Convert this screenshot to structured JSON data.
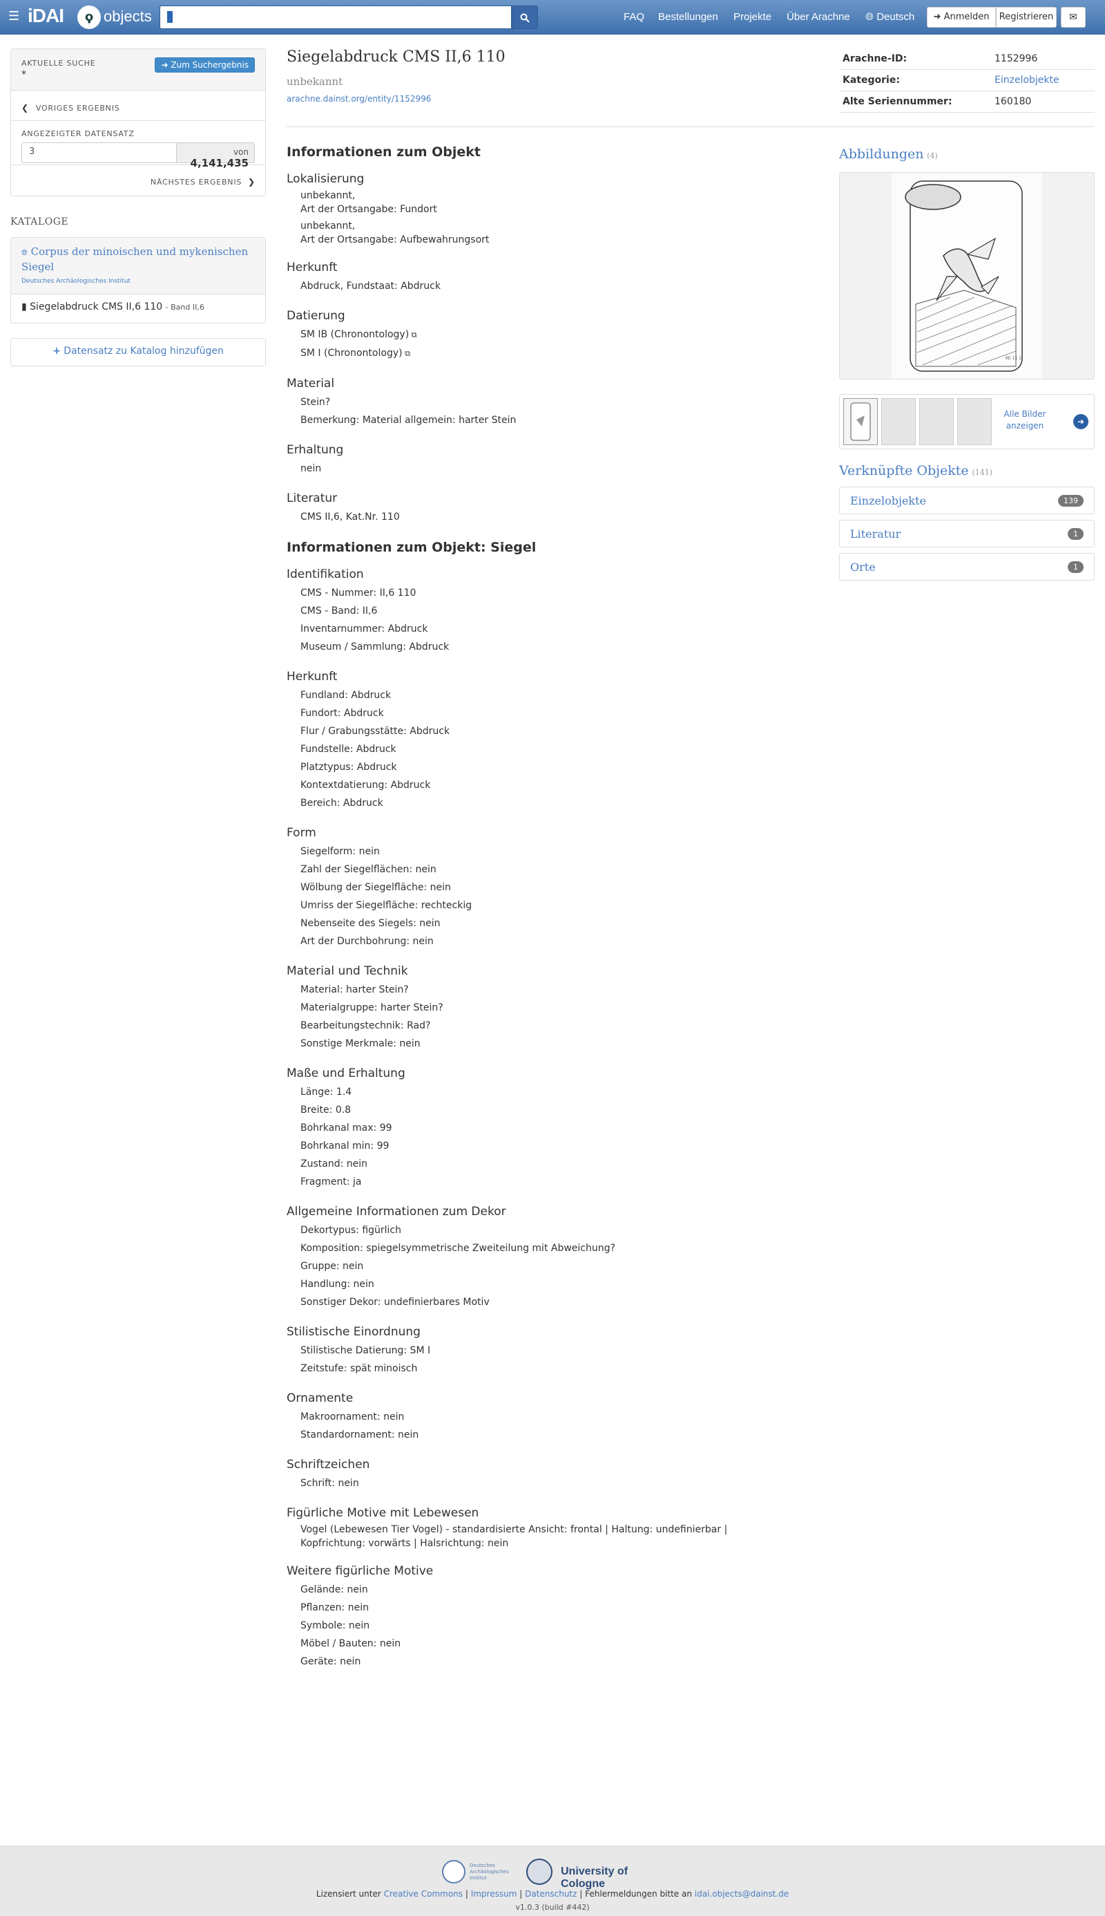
{
  "nav": {
    "logo": "iDAI",
    "brand": "objects",
    "search_value": "",
    "links": [
      "FAQ",
      "Bestellungen",
      "Projekte",
      "Über Arachne"
    ],
    "language": "Deutsch",
    "login": "Anmelden",
    "register": "Registrieren"
  },
  "search_panel": {
    "current_label": "Aktuelle Suche",
    "current_value": "*",
    "back_button": "Zum Suchergebnis",
    "prev": "Voriges Ergebnis",
    "record_label": "Angezeigter Datensatz",
    "record_value": "3",
    "of_label": "von",
    "total": "4,141,435",
    "next": "Nächstes Ergebnis"
  },
  "catalogs": {
    "title": "Kataloge",
    "catalog_name": "Corpus der minoischen und mykenischen Siegel",
    "catalog_org": "Deutsches Archäologisches Institut",
    "entry_label": "Siegelabdruck CMS II,6 110",
    "entry_band": "- Band II,6",
    "add_button": "Datensatz zu Katalog hinzufügen"
  },
  "object": {
    "title": "Siegelabdruck CMS II,6 110",
    "subtitle": "unbekannt",
    "url": "arachne.dainst.org/entity/1152996"
  },
  "meta": [
    {
      "key": "Arachne-ID:",
      "value": "1152996"
    },
    {
      "key": "Kategorie:",
      "value": "Einzelobjekte"
    },
    {
      "key": "Alte Seriennummer:",
      "value": "160180"
    }
  ],
  "sections": [
    {
      "title": "Informationen zum Objekt",
      "groups": [
        {
          "title": "Lokalisierung",
          "items": [
            "unbekannt,\nArt der Ortsangabe: Fundort",
            "unbekannt,\nArt der Ortsangabe: Aufbewahrungsort"
          ]
        },
        {
          "title": "Herkunft",
          "items": [
            "Abdruck, Fundstaat: Abdruck"
          ]
        },
        {
          "title": "Datierung",
          "items": [
            "SM IB (Chronontology)",
            "SM I (Chronontology)"
          ]
        },
        {
          "title": "Material",
          "items": [
            "Stein?",
            "Bemerkung: Material allgemein: harter Stein"
          ]
        },
        {
          "title": "Erhaltung",
          "items": [
            "nein"
          ]
        },
        {
          "title": "Literatur",
          "items": [
            "CMS II,6, Kat.Nr. 110"
          ]
        }
      ]
    },
    {
      "title": "Informationen zum Objekt: Siegel",
      "groups": [
        {
          "title": "Identifikation",
          "items": [
            "CMS - Nummer: II,6 110",
            "CMS - Band: II,6",
            "Inventarnummer: Abdruck",
            "Museum / Sammlung: Abdruck"
          ]
        },
        {
          "title": "Herkunft",
          "items": [
            "Fundland: Abdruck",
            "Fundort: Abdruck",
            "Flur / Grabungsstätte: Abdruck",
            "Fundstelle: Abdruck",
            "Platztypus: Abdruck",
            "Kontextdatierung: Abdruck",
            "Bereich: Abdruck"
          ]
        },
        {
          "title": "Form",
          "items": [
            "Siegelform: nein",
            "Zahl der Siegelflächen: nein",
            "Wölbung der Siegelfläche: nein",
            "Umriss der Siegelfläche: rechteckig",
            "Nebenseite des Siegels: nein",
            "Art der Durchbohrung: nein"
          ]
        },
        {
          "title": "Material und Technik",
          "items": [
            "Material: harter Stein?",
            "Materialgruppe: harter Stein?",
            "Bearbeitungstechnik: Rad?",
            "Sonstige Merkmale: nein"
          ]
        },
        {
          "title": "Maße und Erhaltung",
          "items": [
            "Länge: 1.4",
            "Breite: 0.8",
            "Bohrkanal max: 99",
            "Bohrkanal min: 99",
            "Zustand: nein",
            "Fragment: ja"
          ]
        },
        {
          "title": "Allgemeine Informationen zum Dekor",
          "items": [
            "Dekortypus: figürlich",
            "Komposition: spiegelsymmetrische Zweiteilung mit Abweichung?",
            "Gruppe: nein",
            "Handlung: nein",
            "Sonstiger Dekor: undefinierbares Motiv"
          ]
        },
        {
          "title": "Stilistische Einordnung",
          "items": [
            "Stilistische Datierung: SM I",
            "Zeitstufe: spät minoisch"
          ]
        },
        {
          "title": "Ornamente",
          "items": [
            "Makroornament: nein",
            "Standardornament: nein"
          ]
        },
        {
          "title": "Schriftzeichen",
          "items": [
            "Schrift: nein"
          ]
        },
        {
          "title": "Figürliche Motive mit Lebewesen",
          "items": [
            "Vogel (Lebewesen Tier Vogel) - standardisierte Ansicht: frontal | Haltung: undefinierbar | Kopfrichtung: vorwärts | Halsrichtung: nein"
          ]
        },
        {
          "title": "Weitere figürliche Motive",
          "items": [
            "Gelände: nein",
            "Pflanzen: nein",
            "Symbole: nein",
            "Möbel / Bauten: nein",
            "Geräte: nein"
          ]
        }
      ]
    }
  ],
  "images": {
    "title": "Abbildungen",
    "count": "(4)",
    "caption_mark": "KE 11 1",
    "all_label": "Alle Bilder anzeigen"
  },
  "linked": {
    "title": "Verknüpfte Objekte",
    "count": "(141)",
    "items": [
      {
        "label": "Einzelobjekte",
        "count": "139"
      },
      {
        "label": "Literatur",
        "count": "1"
      },
      {
        "label": "Orte",
        "count": "1"
      }
    ]
  },
  "footer": {
    "dai_label": "Deutsches Archäologisches Institut",
    "uoc_label": "University of Cologne",
    "license_prefix": "Lizensiert unter",
    "license_link": "Creative Commons",
    "impressum": "Impressum",
    "datenschutz": "Datenschutz",
    "errors_prefix": "Fehlermeldungen bitte an",
    "email": "idai.objects@dainst.de",
    "version": "v1.0.3 (build #442)"
  },
  "colors": {
    "accent": "#4a7ec2",
    "navbar": "#4f7fba",
    "primary_button": "#428bca"
  }
}
